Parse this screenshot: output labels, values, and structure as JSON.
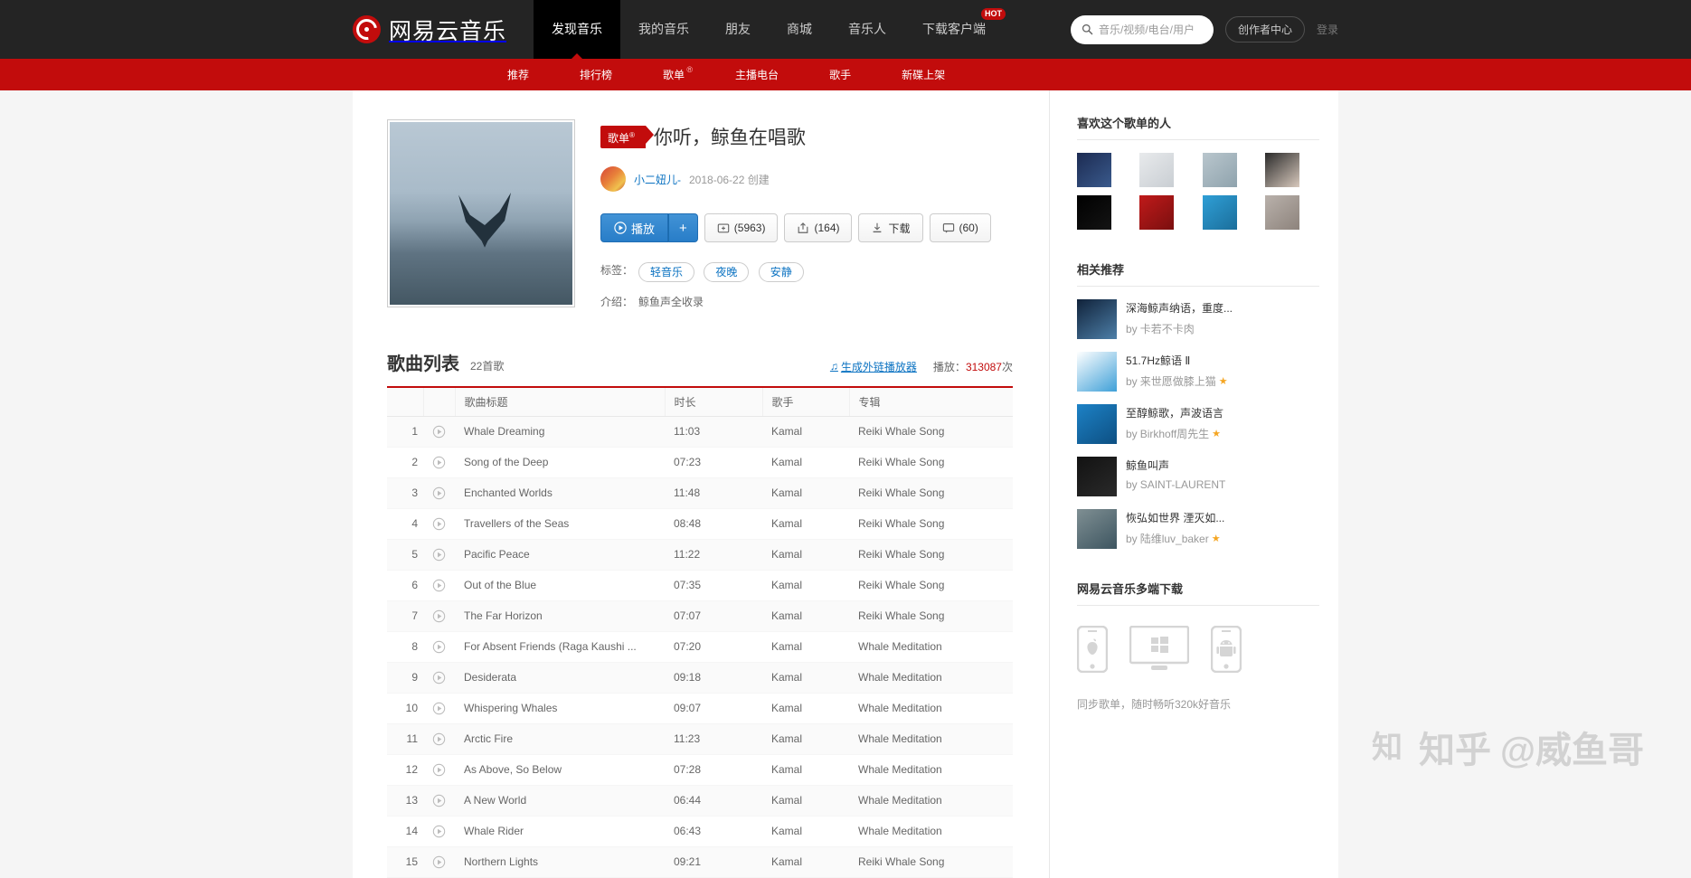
{
  "header": {
    "logo_text": "网易云音乐",
    "nav": [
      {
        "label": "发现音乐",
        "active": true,
        "hot": false
      },
      {
        "label": "我的音乐",
        "active": false,
        "hot": false
      },
      {
        "label": "朋友",
        "active": false,
        "hot": false
      },
      {
        "label": "商城",
        "active": false,
        "hot": false
      },
      {
        "label": "音乐人",
        "active": false,
        "hot": false
      },
      {
        "label": "下载客户端",
        "active": false,
        "hot": true
      }
    ],
    "hot_badge": "HOT",
    "search_placeholder": "音乐/视频/电台/用户",
    "search_value": "",
    "creator_button": "创作者中心",
    "login_link": "登录"
  },
  "subnav": {
    "items": [
      {
        "label": "推荐",
        "badge": ""
      },
      {
        "label": "排行榜",
        "badge": ""
      },
      {
        "label": "歌单",
        "badge": "®"
      },
      {
        "label": "主播电台",
        "badge": ""
      },
      {
        "label": "歌手",
        "badge": ""
      },
      {
        "label": "新碟上架",
        "badge": ""
      }
    ]
  },
  "playlist": {
    "type_tag": "歌单",
    "type_tag_sup": "®",
    "title": "你听，鲸鱼在唱歌",
    "creator": "小二妞儿-",
    "created_date": "2018-06-22 创建",
    "buttons": {
      "play": "播放",
      "add": "+",
      "collect": "(5963)",
      "share": "(164)",
      "download": "下载",
      "comment": "(60)"
    },
    "tags_label": "标签：",
    "tags": [
      "轻音乐",
      "夜晚",
      "安静"
    ],
    "desc_label": "介绍：",
    "desc": "鲸鱼声全收录"
  },
  "songlist": {
    "title": "歌曲列表",
    "count": "22首歌",
    "ext_player_link": "生成外链播放器",
    "play_count_label": "播放：",
    "play_count": "313087",
    "play_count_suffix": "次",
    "columns": [
      "",
      "",
      "歌曲标题",
      "时长",
      "歌手",
      "专辑"
    ],
    "rows": [
      {
        "num": "1",
        "title": "Whale Dreaming",
        "dur": "11:03",
        "artist": "Kamal",
        "album": "Reiki Whale Song"
      },
      {
        "num": "2",
        "title": "Song of the Deep",
        "dur": "07:23",
        "artist": "Kamal",
        "album": "Reiki Whale Song"
      },
      {
        "num": "3",
        "title": "Enchanted Worlds",
        "dur": "11:48",
        "artist": "Kamal",
        "album": "Reiki Whale Song"
      },
      {
        "num": "4",
        "title": "Travellers of the Seas",
        "dur": "08:48",
        "artist": "Kamal",
        "album": "Reiki Whale Song"
      },
      {
        "num": "5",
        "title": "Pacific Peace",
        "dur": "11:22",
        "artist": "Kamal",
        "album": "Reiki Whale Song"
      },
      {
        "num": "6",
        "title": "Out of the Blue",
        "dur": "07:35",
        "artist": "Kamal",
        "album": "Reiki Whale Song"
      },
      {
        "num": "7",
        "title": "The Far Horizon",
        "dur": "07:07",
        "artist": "Kamal",
        "album": "Reiki Whale Song"
      },
      {
        "num": "8",
        "title": "For Absent Friends (Raga Kaushi ...",
        "dur": "07:20",
        "artist": "Kamal",
        "album": "Whale Meditation"
      },
      {
        "num": "9",
        "title": "Desiderata",
        "dur": "09:18",
        "artist": "Kamal",
        "album": "Whale Meditation"
      },
      {
        "num": "10",
        "title": "Whispering Whales",
        "dur": "09:07",
        "artist": "Kamal",
        "album": "Whale Meditation"
      },
      {
        "num": "11",
        "title": "Arctic Fire",
        "dur": "11:23",
        "artist": "Kamal",
        "album": "Whale Meditation"
      },
      {
        "num": "12",
        "title": "As Above, So Below",
        "dur": "07:28",
        "artist": "Kamal",
        "album": "Whale Meditation"
      },
      {
        "num": "13",
        "title": "A New World",
        "dur": "06:44",
        "artist": "Kamal",
        "album": "Whale Meditation"
      },
      {
        "num": "14",
        "title": "Whale Rider",
        "dur": "06:43",
        "artist": "Kamal",
        "album": "Whale Meditation"
      },
      {
        "num": "15",
        "title": "Northern Lights",
        "dur": "09:21",
        "artist": "Kamal",
        "album": "Reiki Whale Song"
      }
    ]
  },
  "sidebar": {
    "likers_title": "喜欢这个歌单的人",
    "likers": [
      {
        "c1": "#1c2b52",
        "c2": "#3a5a8c"
      },
      {
        "c1": "#e8eaec",
        "c2": "#c9ced3"
      },
      {
        "c1": "#b9c6cd",
        "c2": "#8fa3ad"
      },
      {
        "c1": "#2a2a2a",
        "c2": "#d8c9bd"
      },
      {
        "c1": "#000000",
        "c2": "#141414"
      },
      {
        "c1": "#c01a1a",
        "c2": "#7a0f0f"
      },
      {
        "c1": "#2f9fd6",
        "c2": "#1b6e9b"
      },
      {
        "c1": "#b9b1ab",
        "c2": "#8d837c"
      }
    ],
    "rec_title": "相关推荐",
    "recommends": [
      {
        "name": "深海鲸声纳语，重度...",
        "by_label": "by",
        "by": "卡若不卡肉",
        "star": false,
        "c1": "#10223a",
        "c2": "#4d7fa8"
      },
      {
        "name": "51.7Hz鲸语 Ⅱ",
        "by_label": "by",
        "by": "来世愿做膝上猫",
        "star": true,
        "c1": "#ffffff",
        "c2": "#3fa0d8"
      },
      {
        "name": "至醇鲸歌，声波语言",
        "by_label": "by",
        "by": "Birkhoff周先生",
        "star": true,
        "c1": "#1d82c6",
        "c2": "#0d4f82"
      },
      {
        "name": "鲸鱼叫声",
        "by_label": "by",
        "by": "SAINT-LAURENT",
        "star": false,
        "c1": "#121212",
        "c2": "#2a2a2a"
      },
      {
        "name": "恢弘如世界 湮灭如...",
        "by_label": "by",
        "by": "陆维luv_baker",
        "star": true,
        "c1": "#7f8f93",
        "c2": "#3d5560"
      }
    ],
    "download_title": "网易云音乐多端下载",
    "download_icons": [
      "iphone-icon",
      "windows-icon",
      "android-icon"
    ],
    "download_note": "同步歌单，随时畅听320k好音乐"
  },
  "watermark": {
    "brand": "知乎",
    "user": "@威鱼哥"
  }
}
